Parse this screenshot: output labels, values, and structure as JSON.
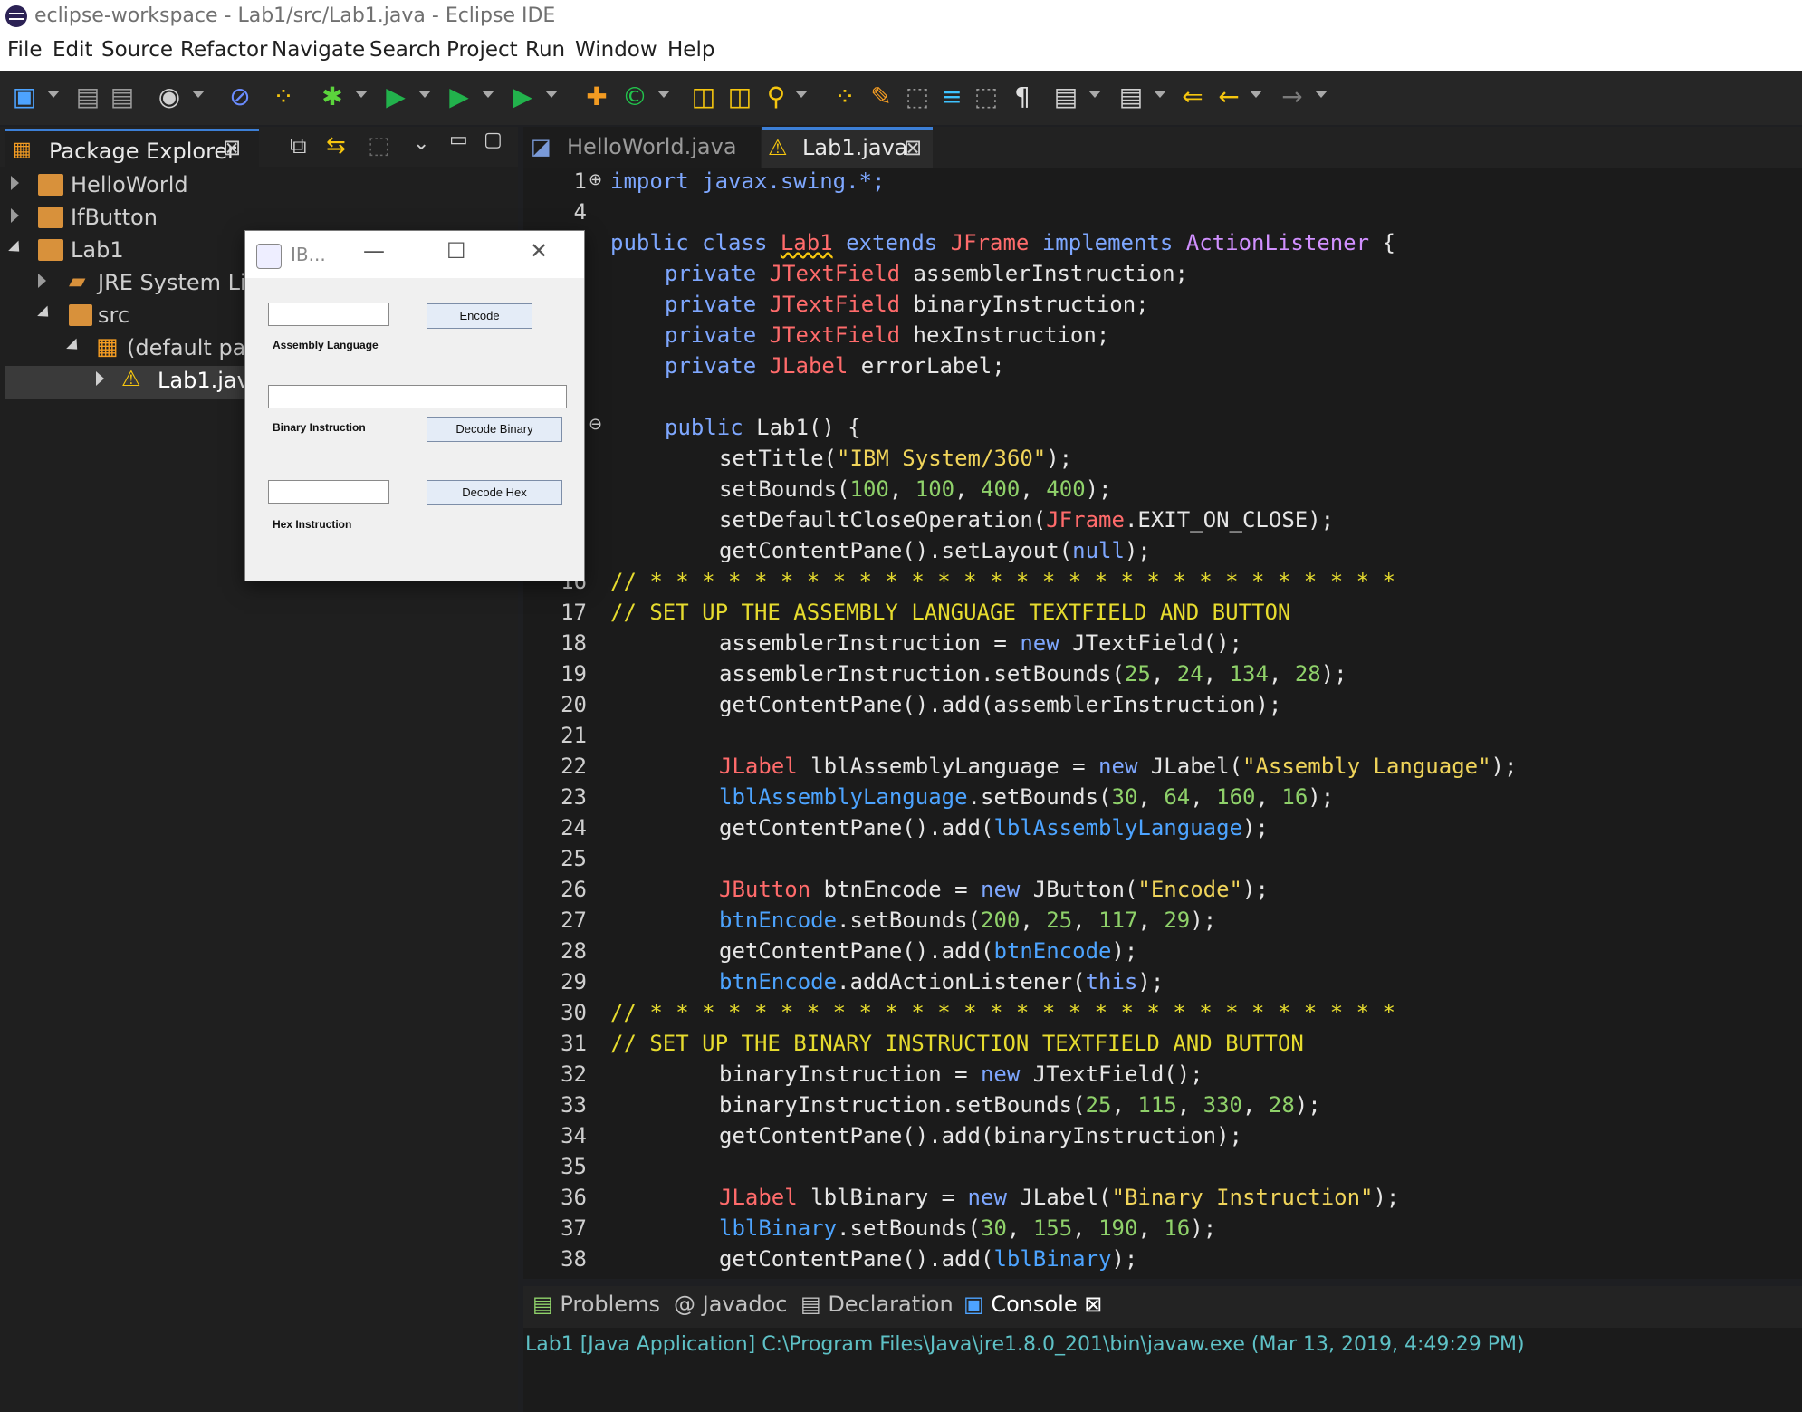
{
  "window": {
    "title": "eclipse-workspace - Lab1/src/Lab1.java - Eclipse IDE"
  },
  "menu": [
    "File",
    "Edit",
    "Source",
    "Refactor",
    "Navigate",
    "Search",
    "Project",
    "Run",
    "Window",
    "Help"
  ],
  "package_explorer": {
    "tab_label": "Package Explorer",
    "items": [
      "HelloWorld",
      "IfButton",
      "Lab1",
      "JRE System Libr",
      "src",
      "(default pac",
      "Lab1.java"
    ]
  },
  "editor": {
    "tabs": [
      "HelloWorld.java",
      "Lab1.java"
    ],
    "line_numbers": [
      "1",
      "4",
      "16",
      "17",
      "18",
      "19",
      "20",
      "21",
      "22",
      "23",
      "24",
      "25",
      "26",
      "27",
      "28",
      "29",
      "30",
      "31",
      "32",
      "33",
      "34",
      "35",
      "36",
      "37",
      "38"
    ],
    "code": {
      "l1": "import javax.swing.*;",
      "l3": "public class Lab1 extends JFrame implements ActionListener {",
      "l4": "private JTextField assemblerInstruction;",
      "l5": "private JTextField binaryInstruction;",
      "l6": "private JTextField hexInstruction;",
      "l7": "private JLabel errorLabel;",
      "l9": "public Lab1() {",
      "l10": "setTitle(\"IBM System/360\");",
      "l11": "setBounds(100, 100, 400, 400);",
      "l12": "setDefaultCloseOperation(JFrame.EXIT_ON_CLOSE);",
      "l13": "getContentPane().setLayout(null);",
      "c16": "// * * * * * * * * * * * * * * * * * * * * * * * * * * * * *",
      "c17": "// SET UP THE ASSEMBLY LANGUAGE TEXTFIELD AND BUTTON",
      "l18": "assemblerInstruction = new JTextField();",
      "l19": "assemblerInstruction.setBounds(25, 24, 134, 28);",
      "l20": "getContentPane().add(assemblerInstruction);",
      "l22": "JLabel lblAssemblyLanguage = new JLabel(\"Assembly Language\");",
      "l23": "lblAssemblyLanguage.setBounds(30, 64, 160, 16);",
      "l24": "getContentPane().add(lblAssemblyLanguage);",
      "l26": "JButton btnEncode = new JButton(\"Encode\");",
      "l27": "btnEncode.setBounds(200, 25, 117, 29);",
      "l28": "getContentPane().add(btnEncode);",
      "l29": "btnEncode.addActionListener(this);",
      "c30": "// * * * * * * * * * * * * * * * * * * * * * * * * * * * * *",
      "c31": "// SET UP THE BINARY INSTRUCTION TEXTFIELD AND BUTTON",
      "l32": "binaryInstruction = new JTextField();",
      "l33": "binaryInstruction.setBounds(25, 115, 330, 28);",
      "l34": "getContentPane().add(binaryInstruction);",
      "l36": "JLabel lblBinary = new JLabel(\"Binary Instruction\");",
      "l37": "lblBinary.setBounds(30, 155, 190, 16);",
      "l38": "getContentPane().add(lblBinary);"
    }
  },
  "bottom_panel": {
    "tabs": [
      "Problems",
      "Javadoc",
      "Declaration",
      "Console"
    ],
    "console_text": "Lab1 [Java Application] C:\\Program Files\\Java\\jre1.8.0_201\\bin\\javaw.exe (Mar 13, 2019, 4:49:29 PM)"
  },
  "swing_window": {
    "title": "IB...",
    "encode_label": "Encode",
    "assembly_label": "Assembly Language",
    "binary_label": "Binary Instruction",
    "decode_binary_label": "Decode Binary",
    "hex_label": "Hex Instruction",
    "decode_hex_label": "Decode Hex"
  }
}
